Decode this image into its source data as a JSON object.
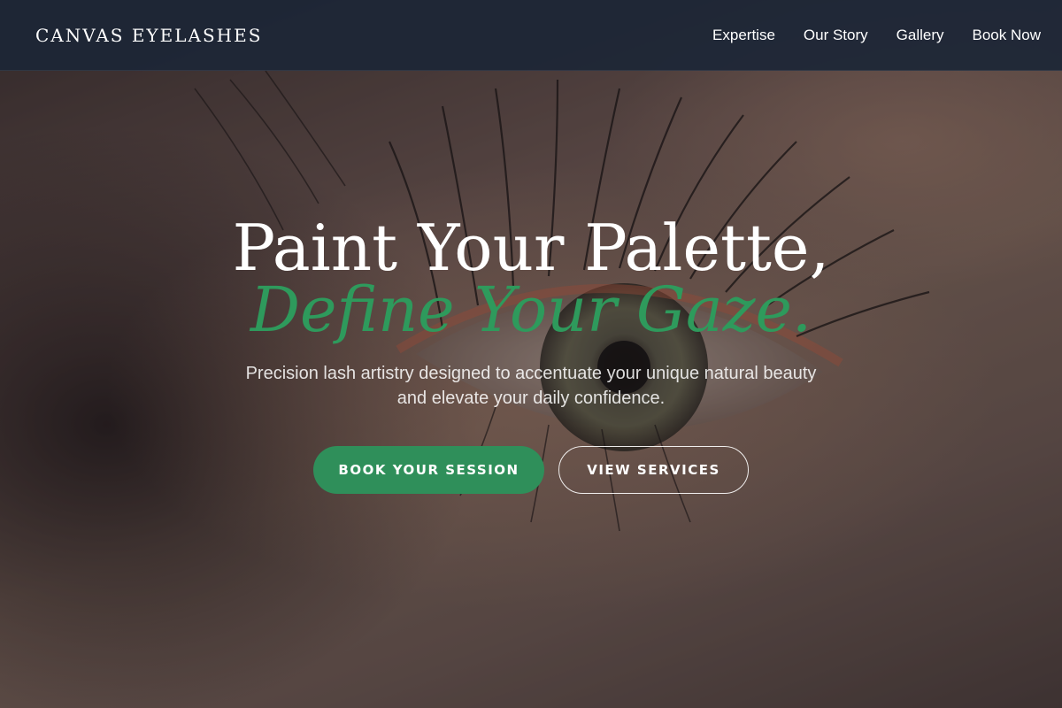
{
  "nav": {
    "brand": "CANVAS EYELASHES",
    "links": [
      "Expertise",
      "Our Story",
      "Gallery",
      "Book Now"
    ]
  },
  "hero": {
    "headline_line1": "Paint Your Palette,",
    "headline_line2": "Define Your Gaze.",
    "subtitle": "Precision lash artistry designed to accentuate your unique natural beauty and elevate your daily confidence.",
    "primary_button": "BOOK YOUR SESSION",
    "secondary_button": "VIEW SERVICES",
    "background_image": "close-up-eye-photo",
    "colors": {
      "accent_green": "#2e9a5c",
      "navbar_bg": "#1c2636",
      "button_primary": "#2f8f5a"
    }
  }
}
